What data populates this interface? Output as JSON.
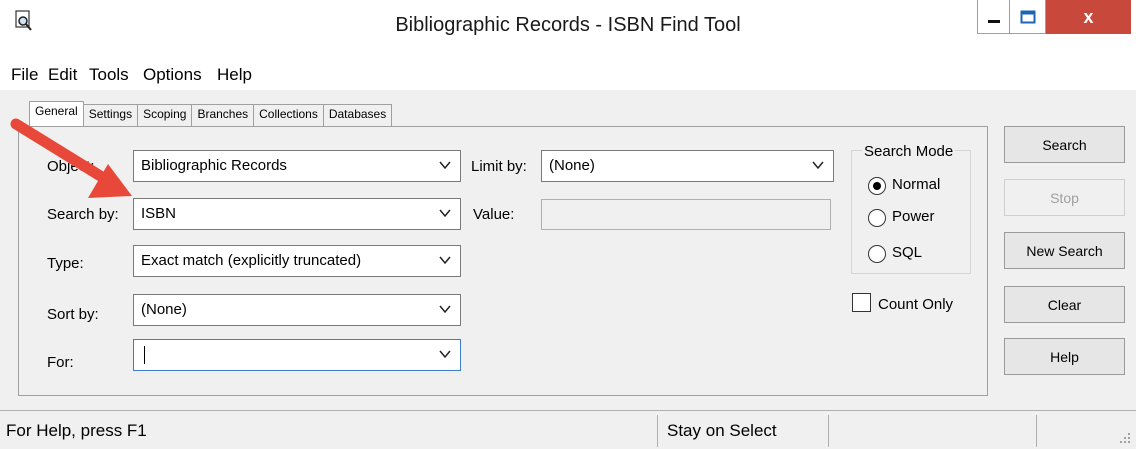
{
  "window": {
    "title": "Bibliographic Records - ISBN Find Tool",
    "close_glyph": "x"
  },
  "menu": {
    "items": [
      "File",
      "Edit",
      "Tools",
      "Options",
      "Help"
    ]
  },
  "tabs": [
    "General",
    "Settings",
    "Scoping",
    "Branches",
    "Collections",
    "Databases"
  ],
  "form": {
    "object_label": "Object:",
    "object_value": "Bibliographic Records",
    "search_by_label": "Search by:",
    "search_by_value": "ISBN",
    "type_label": "Type:",
    "type_value": "Exact match (explicitly truncated)",
    "sort_by_label": "Sort by:",
    "sort_by_value": "(None)",
    "for_label": "For:",
    "for_value": "",
    "limit_by_label": "Limit by:",
    "limit_by_value": "(None)",
    "value_label": "Value:",
    "value_value": ""
  },
  "search_mode": {
    "title": "Search Mode",
    "options": [
      "Normal",
      "Power",
      "SQL"
    ],
    "selected": "Normal"
  },
  "count_only": {
    "label": "Count Only",
    "checked": false
  },
  "buttons": {
    "search": "Search",
    "stop": "Stop",
    "new_search": "New Search",
    "clear": "Clear",
    "help": "Help"
  },
  "status": {
    "help": "For Help, press F1",
    "mode": "Stay on Select"
  },
  "colors": {
    "close_button": "#c9483c",
    "annotation_arrow": "#e8483a"
  }
}
